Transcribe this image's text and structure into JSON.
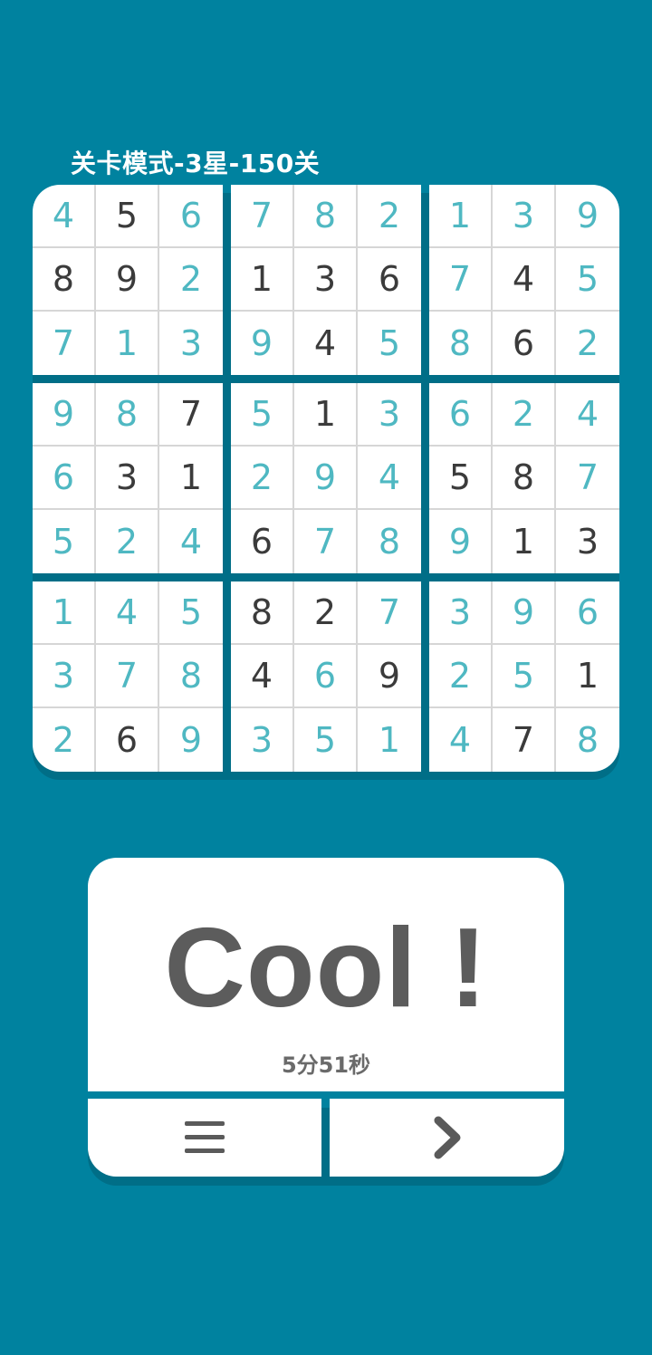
{
  "header": {
    "level_title": "关卡模式-3星-150关"
  },
  "board": {
    "values": [
      [
        4,
        5,
        6,
        7,
        8,
        2,
        1,
        3,
        9
      ],
      [
        8,
        9,
        2,
        1,
        3,
        6,
        7,
        4,
        5
      ],
      [
        7,
        1,
        3,
        9,
        4,
        5,
        8,
        6,
        2
      ],
      [
        9,
        8,
        7,
        5,
        1,
        3,
        6,
        2,
        4
      ],
      [
        6,
        3,
        1,
        2,
        9,
        4,
        5,
        8,
        7
      ],
      [
        5,
        2,
        4,
        6,
        7,
        8,
        9,
        1,
        3
      ],
      [
        1,
        4,
        5,
        8,
        2,
        7,
        3,
        9,
        6
      ],
      [
        3,
        7,
        8,
        4,
        6,
        9,
        2,
        5,
        1
      ],
      [
        2,
        6,
        9,
        3,
        5,
        1,
        4,
        7,
        8
      ]
    ],
    "given": [
      [
        0,
        1,
        0,
        0,
        0,
        0,
        0,
        0,
        0
      ],
      [
        1,
        1,
        0,
        1,
        1,
        1,
        0,
        1,
        0
      ],
      [
        0,
        0,
        0,
        0,
        1,
        0,
        0,
        1,
        0
      ],
      [
        0,
        0,
        1,
        0,
        1,
        0,
        0,
        0,
        0
      ],
      [
        0,
        1,
        1,
        0,
        0,
        0,
        1,
        1,
        0
      ],
      [
        0,
        0,
        0,
        1,
        0,
        0,
        0,
        1,
        1
      ],
      [
        0,
        0,
        0,
        1,
        1,
        0,
        0,
        0,
        0
      ],
      [
        0,
        0,
        0,
        1,
        0,
        1,
        0,
        0,
        1
      ],
      [
        0,
        1,
        0,
        0,
        0,
        0,
        0,
        1,
        0
      ]
    ],
    "colors": {
      "given": "#3B3B3B",
      "filled": "#4FB8C2",
      "background": "#00829F"
    }
  },
  "result": {
    "message": "Cool !",
    "time": "5分51秒"
  },
  "buttons": {
    "menu_icon": "menu-icon",
    "next_icon": "chevron-right-icon"
  }
}
